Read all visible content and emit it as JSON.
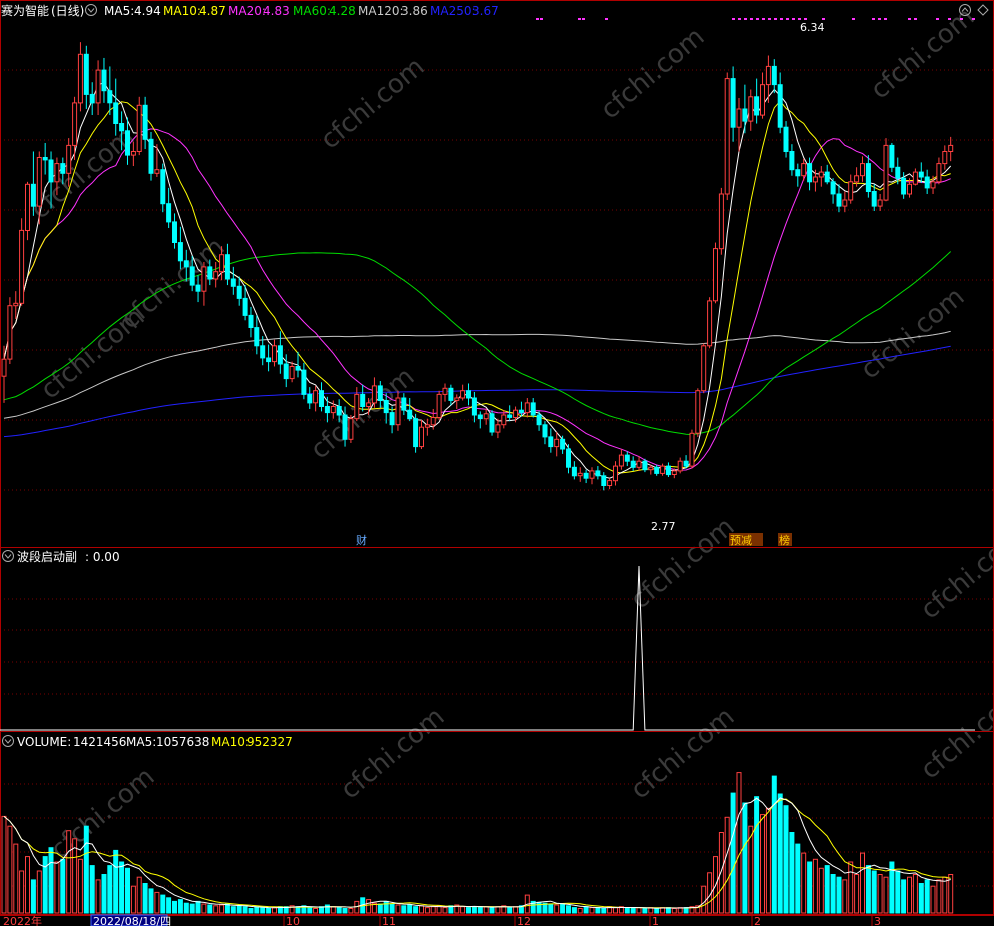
{
  "main_panel": {
    "stock_name": "赛为智能",
    "period": "(日线)",
    "ma5_label": "MA5:",
    "ma5_value": "4.94",
    "ma10_label": "MA10:",
    "ma10_value": "4.87",
    "ma20_label": "MA20:",
    "ma20_value": "4.83",
    "ma60_label": "MA60:",
    "ma60_value": "4.28",
    "ma120_label": "MA120:",
    "ma120_value": "3.86",
    "ma250_label": "MA250:",
    "ma250_value": "3.67",
    "high_mark": "6.34",
    "low_mark": "2.77",
    "tag_cai": "财",
    "tag_yujian": "预减",
    "tag_bang": "榜"
  },
  "indicator_panel": {
    "name": "波段启动副",
    "value": ": 0.00"
  },
  "volume_panel": {
    "vol_label": "VOLUME:",
    "vol_value": "1421456",
    "ma5_label": "MA5:",
    "ma5_value": "1057638",
    "ma10_label": "MA10:",
    "ma10_value": "952327"
  },
  "x_axis": {
    "year_label": "2022年",
    "cursor_date": "2022/08/18/四",
    "ticks": [
      "10",
      "11",
      "12",
      "1",
      "2",
      "3"
    ]
  },
  "watermark": "cfchi.com",
  "colors": {
    "ma5": "#ffffff",
    "ma10": "#ffff00",
    "ma20": "#ff33ff",
    "ma60": "#00dd00",
    "ma120": "#c8c8c8",
    "ma250": "#2222ff",
    "up": "#ff4040",
    "down": "#00ffff",
    "grid": "#7a0000"
  },
  "chart_data": {
    "type": "candlestick",
    "price_range": [
      2.45,
      6.55
    ],
    "candles_ohlc": [
      [
        3.7,
        3.95,
        3.48,
        3.84
      ],
      [
        3.84,
        4.35,
        3.8,
        4.28
      ],
      [
        4.28,
        4.4,
        4.17,
        4.3
      ],
      [
        4.3,
        5.0,
        4.28,
        4.9
      ],
      [
        4.9,
        5.3,
        4.82,
        5.28
      ],
      [
        5.28,
        5.55,
        5.02,
        5.1
      ],
      [
        5.1,
        5.55,
        4.95,
        5.5
      ],
      [
        5.5,
        5.62,
        5.36,
        5.48
      ],
      [
        5.48,
        5.55,
        5.08,
        5.3
      ],
      [
        5.3,
        5.5,
        5.19,
        5.45
      ],
      [
        5.45,
        5.5,
        5.28,
        5.37
      ],
      [
        5.37,
        5.66,
        5.26,
        5.6
      ],
      [
        5.6,
        6.0,
        5.48,
        5.95
      ],
      [
        5.95,
        6.45,
        5.88,
        6.35
      ],
      [
        6.35,
        6.42,
        5.9,
        6.02
      ],
      [
        6.02,
        6.12,
        5.85,
        5.95
      ],
      [
        5.95,
        6.3,
        5.85,
        6.22
      ],
      [
        6.22,
        6.32,
        5.95,
        6.05
      ],
      [
        6.05,
        6.25,
        5.85,
        5.95
      ],
      [
        5.95,
        6.15,
        5.68,
        5.78
      ],
      [
        5.78,
        5.88,
        5.56,
        5.72
      ],
      [
        5.72,
        5.83,
        5.44,
        5.52
      ],
      [
        5.52,
        5.63,
        5.43,
        5.55
      ],
      [
        5.55,
        6.0,
        5.52,
        5.93
      ],
      [
        5.93,
        6.0,
        5.57,
        5.65
      ],
      [
        5.65,
        5.71,
        5.31,
        5.37
      ],
      [
        5.37,
        5.61,
        5.34,
        5.4
      ],
      [
        5.4,
        5.45,
        5.05,
        5.12
      ],
      [
        5.12,
        5.25,
        4.92,
        4.97
      ],
      [
        4.97,
        5.04,
        4.75,
        4.8
      ],
      [
        4.8,
        4.93,
        4.58,
        4.65
      ],
      [
        4.65,
        4.74,
        4.48,
        4.6
      ],
      [
        4.6,
        4.69,
        4.4,
        4.45
      ],
      [
        4.45,
        4.53,
        4.31,
        4.4
      ],
      [
        4.4,
        4.64,
        4.28,
        4.6
      ],
      [
        4.6,
        4.66,
        4.45,
        4.5
      ],
      [
        4.5,
        4.64,
        4.43,
        4.56
      ],
      [
        4.56,
        4.77,
        4.49,
        4.7
      ],
      [
        4.7,
        4.79,
        4.45,
        4.5
      ],
      [
        4.5,
        4.6,
        4.37,
        4.44
      ],
      [
        4.44,
        4.52,
        4.28,
        4.34
      ],
      [
        4.34,
        4.45,
        4.16,
        4.2
      ],
      [
        4.2,
        4.27,
        4.02,
        4.1
      ],
      [
        4.1,
        4.2,
        3.88,
        3.95
      ],
      [
        3.95,
        4.03,
        3.79,
        3.85
      ],
      [
        3.85,
        3.96,
        3.74,
        3.82
      ],
      [
        3.82,
        4.0,
        3.78,
        3.95
      ],
      [
        3.95,
        4.07,
        3.72,
        3.8
      ],
      [
        3.8,
        3.88,
        3.61,
        3.68
      ],
      [
        3.68,
        3.82,
        3.65,
        3.78
      ],
      [
        3.78,
        3.9,
        3.69,
        3.75
      ],
      [
        3.75,
        3.81,
        3.51,
        3.55
      ],
      [
        3.55,
        3.61,
        3.43,
        3.48
      ],
      [
        3.48,
        3.62,
        3.41,
        3.58
      ],
      [
        3.58,
        3.65,
        3.41,
        3.45
      ],
      [
        3.45,
        3.53,
        3.32,
        3.4
      ],
      [
        3.4,
        3.5,
        3.35,
        3.45
      ],
      [
        3.45,
        3.51,
        3.32,
        3.38
      ],
      [
        3.38,
        3.45,
        3.12,
        3.18
      ],
      [
        3.18,
        3.38,
        3.15,
        3.35
      ],
      [
        3.35,
        3.61,
        3.33,
        3.55
      ],
      [
        3.55,
        3.63,
        3.41,
        3.45
      ],
      [
        3.45,
        3.52,
        3.38,
        3.48
      ],
      [
        3.48,
        3.69,
        3.44,
        3.62
      ],
      [
        3.62,
        3.66,
        3.44,
        3.5
      ],
      [
        3.5,
        3.56,
        3.31,
        3.4
      ],
      [
        3.4,
        3.45,
        3.23,
        3.3
      ],
      [
        3.3,
        3.58,
        3.25,
        3.52
      ],
      [
        3.52,
        3.56,
        3.38,
        3.42
      ],
      [
        3.42,
        3.52,
        3.33,
        3.35
      ],
      [
        3.35,
        3.39,
        3.07,
        3.12
      ],
      [
        3.12,
        3.34,
        3.1,
        3.28
      ],
      [
        3.28,
        3.35,
        3.21,
        3.3
      ],
      [
        3.3,
        3.43,
        3.26,
        3.36
      ],
      [
        3.36,
        3.58,
        3.34,
        3.55
      ],
      [
        3.55,
        3.64,
        3.49,
        3.6
      ],
      [
        3.6,
        3.63,
        3.46,
        3.5
      ],
      [
        3.5,
        3.55,
        3.43,
        3.52
      ],
      [
        3.52,
        3.63,
        3.5,
        3.58
      ],
      [
        3.58,
        3.64,
        3.46,
        3.52
      ],
      [
        3.52,
        3.57,
        3.32,
        3.38
      ],
      [
        3.38,
        3.41,
        3.27,
        3.35
      ],
      [
        3.35,
        3.43,
        3.3,
        3.39
      ],
      [
        3.39,
        3.42,
        3.21,
        3.24
      ],
      [
        3.24,
        3.35,
        3.19,
        3.3
      ],
      [
        3.3,
        3.42,
        3.27,
        3.38
      ],
      [
        3.38,
        3.46,
        3.33,
        3.36
      ],
      [
        3.36,
        3.45,
        3.32,
        3.42
      ],
      [
        3.42,
        3.49,
        3.37,
        3.4
      ],
      [
        3.4,
        3.52,
        3.36,
        3.48
      ],
      [
        3.48,
        3.52,
        3.36,
        3.38
      ],
      [
        3.38,
        3.41,
        3.25,
        3.3
      ],
      [
        3.3,
        3.33,
        3.14,
        3.2
      ],
      [
        3.2,
        3.27,
        3.07,
        3.12
      ],
      [
        3.12,
        3.24,
        3.04,
        3.18
      ],
      [
        3.18,
        3.21,
        3.06,
        3.1
      ],
      [
        3.1,
        3.14,
        2.9,
        2.95
      ],
      [
        2.95,
        3.0,
        2.85,
        2.88
      ],
      [
        2.88,
        2.95,
        2.83,
        2.9
      ],
      [
        2.9,
        2.93,
        2.82,
        2.86
      ],
      [
        2.86,
        2.95,
        2.81,
        2.92
      ],
      [
        2.92,
        2.96,
        2.85,
        2.88
      ],
      [
        2.88,
        2.91,
        2.76,
        2.8
      ],
      [
        2.8,
        2.86,
        2.77,
        2.84
      ],
      [
        2.84,
        3.0,
        2.8,
        2.96
      ],
      [
        2.96,
        3.1,
        2.93,
        3.05
      ],
      [
        3.05,
        3.08,
        2.96,
        3.0
      ],
      [
        3.0,
        3.04,
        2.92,
        2.95
      ],
      [
        2.95,
        3.04,
        2.92,
        3.0
      ],
      [
        3.0,
        3.02,
        2.91,
        2.93
      ],
      [
        2.93,
        2.97,
        2.89,
        2.95
      ],
      [
        2.95,
        2.97,
        2.88,
        2.9
      ],
      [
        2.9,
        2.98,
        2.88,
        2.96
      ],
      [
        2.96,
        2.99,
        2.87,
        2.89
      ],
      [
        2.89,
        2.94,
        2.86,
        2.92
      ],
      [
        2.92,
        3.03,
        2.9,
        3.0
      ],
      [
        3.0,
        3.05,
        2.94,
        2.96
      ],
      [
        2.96,
        3.26,
        2.94,
        3.23
      ],
      [
        3.23,
        3.6,
        3.2,
        3.58
      ],
      [
        3.58,
        3.97,
        3.56,
        3.95
      ],
      [
        3.95,
        4.35,
        3.93,
        4.32
      ],
      [
        4.32,
        4.8,
        4.3,
        4.75
      ],
      [
        4.75,
        5.25,
        4.7,
        5.2
      ],
      [
        5.2,
        6.2,
        5.15,
        6.15
      ],
      [
        6.15,
        6.25,
        5.63,
        5.75
      ],
      [
        5.75,
        5.99,
        5.55,
        5.9
      ],
      [
        5.9,
        6.1,
        5.7,
        5.8
      ],
      [
        5.8,
        6.06,
        5.72,
        6.0
      ],
      [
        6.0,
        6.15,
        5.78,
        5.85
      ],
      [
        5.85,
        6.2,
        5.82,
        6.1
      ],
      [
        6.1,
        6.34,
        5.95,
        6.25
      ],
      [
        6.25,
        6.31,
        6.03,
        6.1
      ],
      [
        6.1,
        6.2,
        5.7,
        5.75
      ],
      [
        5.75,
        5.8,
        5.5,
        5.55
      ],
      [
        5.55,
        5.61,
        5.35,
        5.4
      ],
      [
        5.4,
        5.45,
        5.26,
        5.35
      ],
      [
        5.35,
        5.49,
        5.31,
        5.45
      ],
      [
        5.45,
        5.5,
        5.23,
        5.3
      ],
      [
        5.3,
        5.4,
        5.22,
        5.34
      ],
      [
        5.34,
        5.43,
        5.26,
        5.38
      ],
      [
        5.38,
        5.44,
        5.28,
        5.3
      ],
      [
        5.3,
        5.33,
        5.12,
        5.2
      ],
      [
        5.2,
        5.28,
        5.05,
        5.1
      ],
      [
        5.1,
        5.22,
        5.05,
        5.15
      ],
      [
        5.15,
        5.36,
        5.12,
        5.3
      ],
      [
        5.3,
        5.42,
        5.26,
        5.35
      ],
      [
        5.35,
        5.51,
        5.3,
        5.45
      ],
      [
        5.45,
        5.52,
        5.17,
        5.22
      ],
      [
        5.22,
        5.28,
        5.06,
        5.1
      ],
      [
        5.1,
        5.2,
        5.06,
        5.15
      ],
      [
        5.15,
        5.66,
        5.14,
        5.6
      ],
      [
        5.6,
        5.62,
        5.38,
        5.42
      ],
      [
        5.42,
        5.5,
        5.28,
        5.33
      ],
      [
        5.33,
        5.38,
        5.16,
        5.2
      ],
      [
        5.2,
        5.33,
        5.17,
        5.28
      ],
      [
        5.28,
        5.41,
        5.27,
        5.38
      ],
      [
        5.38,
        5.46,
        5.29,
        5.34
      ],
      [
        5.34,
        5.4,
        5.2,
        5.25
      ],
      [
        5.25,
        5.35,
        5.2,
        5.3
      ],
      [
        5.3,
        5.5,
        5.28,
        5.45
      ],
      [
        5.45,
        5.6,
        5.4,
        5.55
      ],
      [
        5.55,
        5.67,
        5.47,
        5.6
      ]
    ],
    "volume_range": [
      0,
      1800000
    ],
    "volumes": [
      1080000,
      970000,
      770000,
      470000,
      630000,
      370000,
      470000,
      630000,
      730000,
      570000,
      600000,
      920000,
      830000,
      600000,
      970000,
      530000,
      370000,
      430000,
      530000,
      700000,
      570000,
      500000,
      300000,
      400000,
      330000,
      270000,
      230000,
      200000,
      170000,
      130000,
      150000,
      110000,
      100000,
      130000,
      100000,
      90000,
      80000,
      90000,
      100000,
      70000,
      80000,
      70000,
      50000,
      70000,
      60000,
      50000,
      60000,
      70000,
      70000,
      80000,
      70000,
      80000,
      60000,
      50000,
      70000,
      90000,
      70000,
      60000,
      50000,
      50000,
      130000,
      170000,
      150000,
      110000,
      100000,
      130000,
      100000,
      90000,
      80000,
      90000,
      70000,
      80000,
      60000,
      70000,
      80000,
      60000,
      80000,
      90000,
      70000,
      60000,
      70000,
      70000,
      70000,
      60000,
      70000,
      80000,
      60000,
      70000,
      80000,
      200000,
      130000,
      120000,
      110000,
      100000,
      90000,
      100000,
      80000,
      60000,
      50000,
      70000,
      60000,
      60000,
      50000,
      70000,
      60000,
      70000,
      60000,
      50000,
      60000,
      50000,
      60000,
      50000,
      60000,
      60000,
      50000,
      60000,
      60000,
      70000,
      80000,
      300000,
      450000,
      630000,
      900000,
      1070000,
      1340000,
      1570000,
      1230000,
      970000,
      1300000,
      1100000,
      1170000,
      1530000,
      1330000,
      1200000,
      900000,
      770000,
      670000,
      570000,
      600000,
      500000,
      530000,
      430000,
      400000,
      370000,
      570000,
      430000,
      670000,
      530000,
      470000,
      430000,
      400000,
      570000,
      470000,
      370000,
      400000,
      430000,
      330000,
      370000,
      300000,
      370000,
      400000,
      430000
    ],
    "indicator_range": [
      0,
      1
    ],
    "indicator_spike": {
      "index": 108,
      "value": 1.0
    }
  }
}
